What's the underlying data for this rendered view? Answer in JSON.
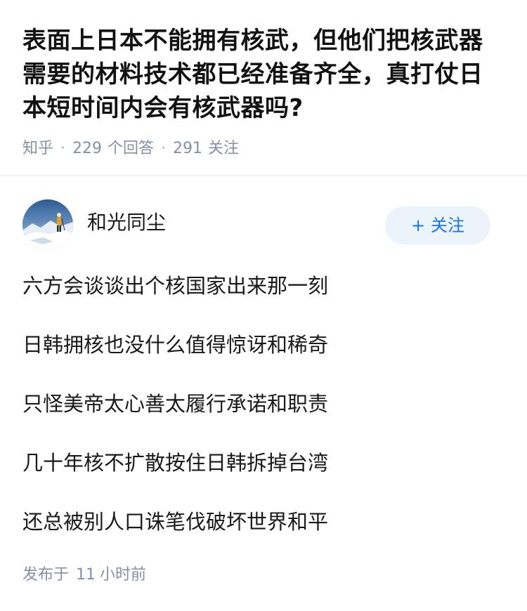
{
  "question": {
    "title": "表面上日本不能拥有核武，但他们把核武器需要的材料技术都已经准备齐全，真打仗日本短时间内会有核武器吗?",
    "source": "知乎",
    "answer_count": "229",
    "answer_label": "个回答",
    "follower_count": "291",
    "follower_label": "关注"
  },
  "answer": {
    "author_name": "和光同尘",
    "avatar_icon": "mountaineer-avatar",
    "follow_button": {
      "icon": "plus-icon",
      "plus": "+",
      "label": "关注",
      "color": "#1772f6",
      "background": "#ebf3fb"
    },
    "lines": [
      "六方会谈谈出个核国家出来那一刻",
      "日韩拥核也没什么值得惊讶和稀奇",
      "只怪美帝太心善太履行承诺和职责",
      "几十年核不扩散按住日韩拆掉台湾",
      "还总被别人口诛笔伐破坏世界和平"
    ],
    "publish_prefix": "发布于",
    "publish_value": "11",
    "publish_unit": "小时前"
  },
  "colors": {
    "meta_text": "#8590a6",
    "title_text": "#121212",
    "divider": "#f2f2f4"
  }
}
